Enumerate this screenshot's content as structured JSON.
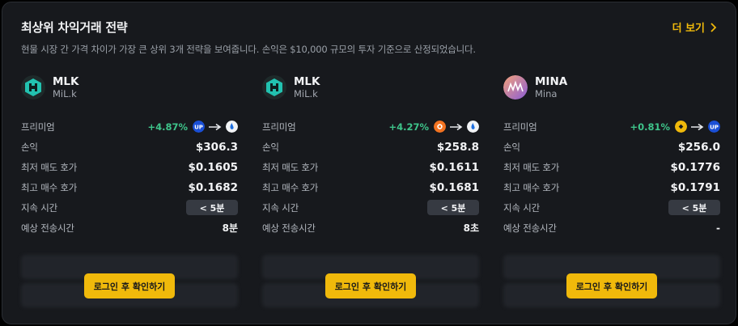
{
  "header": {
    "title": "최상위 차익거래 전략",
    "subtitle": "현물 시장 간 가격 차이가 가장 큰 상위 3개 전략을 보여줍니다. 손익은 $10,000 규모의 투자 기준으로 산정되었습니다.",
    "more_label": "더 보기"
  },
  "labels": {
    "premium": "프리미엄",
    "pnl": "손익",
    "lowest_ask": "최저 매도 호가",
    "highest_bid": "최고 매수 호가",
    "duration": "지속 시간",
    "transfer_time": "예상 전송시간"
  },
  "login_label": "로그인 후 확인하기",
  "colors": {
    "accent": "#f0b90b",
    "positive": "#3ec48a"
  },
  "strategies": [
    {
      "symbol": "MLK",
      "name": "MiL.k",
      "logo_icon": "milk-logo-icon",
      "premium": "+4.87%",
      "from_icon": "upbit-icon",
      "to_icon": "hashkey-icon",
      "pnl": "$306.3",
      "lowest_ask": "$0.1605",
      "highest_bid": "$0.1682",
      "duration": "< 5분",
      "transfer_time": "8분"
    },
    {
      "symbol": "MLK",
      "name": "MiL.k",
      "logo_icon": "milk-logo-icon",
      "premium": "+4.27%",
      "from_icon": "bithumb-icon",
      "to_icon": "hashkey-icon",
      "pnl": "$258.8",
      "lowest_ask": "$0.1611",
      "highest_bid": "$0.1681",
      "duration": "< 5분",
      "transfer_time": "8초"
    },
    {
      "symbol": "MINA",
      "name": "Mina",
      "logo_icon": "mina-logo-icon",
      "premium": "+0.81%",
      "from_icon": "binance-icon",
      "to_icon": "upbit-icon",
      "pnl": "$256.0",
      "lowest_ask": "$0.1776",
      "highest_bid": "$0.1791",
      "duration": "< 5분",
      "transfer_time": "-"
    }
  ]
}
